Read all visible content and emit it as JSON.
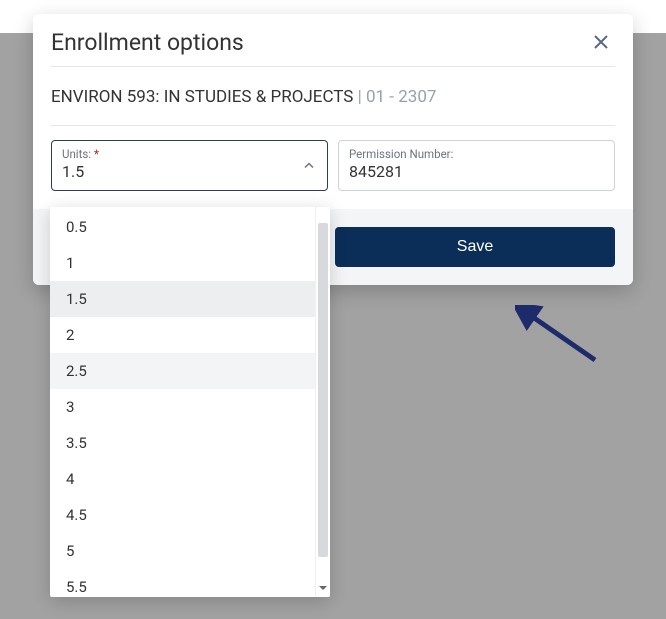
{
  "page_header": {
    "left": "",
    "right": ""
  },
  "modal": {
    "title": "Enrollment options",
    "course": {
      "code_and_name": "ENVIRON 593: IN STUDIES & PROJECTS",
      "section": " | 01 - 2307"
    },
    "units": {
      "label": "Units:",
      "required_marker": "*",
      "value": "1.5",
      "options": [
        "0.5",
        "1",
        "1.5",
        "2",
        "2.5",
        "3",
        "3.5",
        "4",
        "4.5",
        "5",
        "5.5"
      ],
      "selected_index": 2
    },
    "perm": {
      "label": "Permission Number:",
      "value": "845281"
    },
    "footer": {
      "save_label": "Save"
    }
  }
}
